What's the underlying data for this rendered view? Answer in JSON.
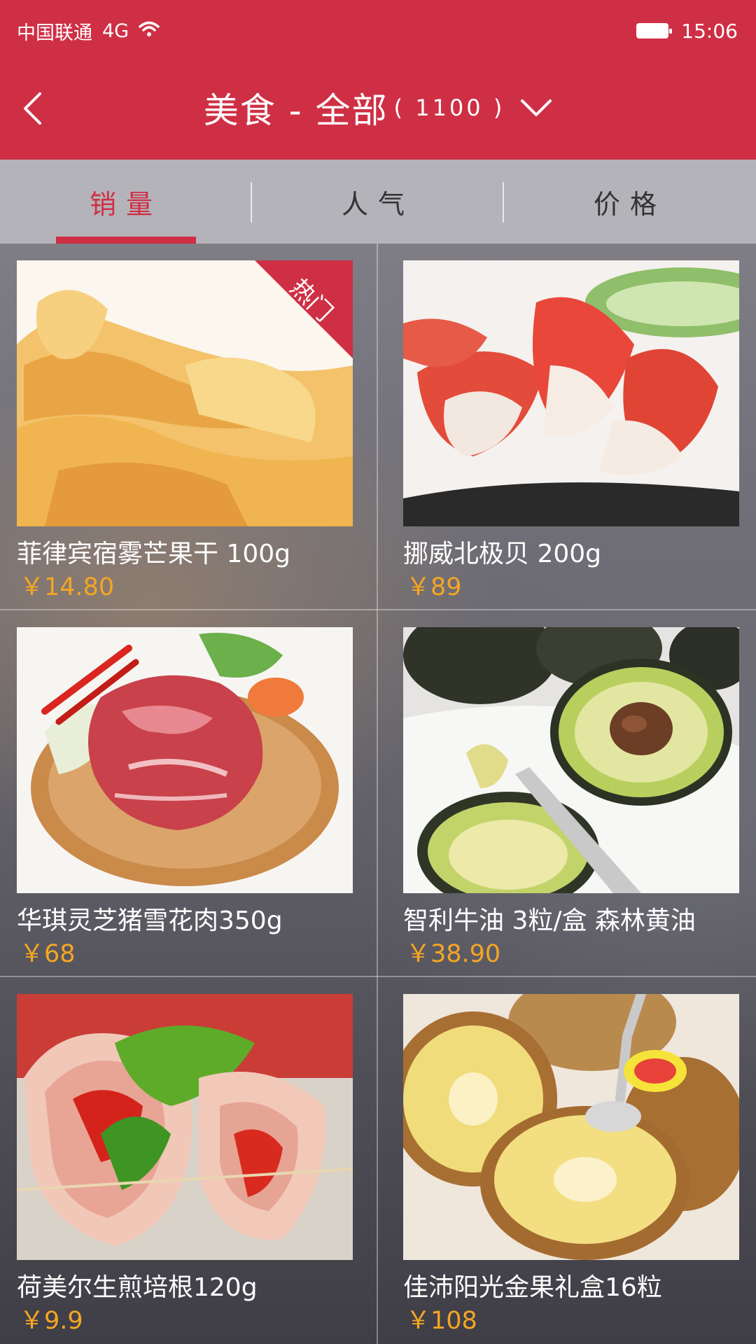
{
  "status_bar": {
    "carrier": "中国联通",
    "network": "4G",
    "time": "15:06"
  },
  "nav": {
    "title": "美食 - 全部",
    "count": "( 1100 )"
  },
  "tabs": [
    {
      "label": "销量",
      "active": true
    },
    {
      "label": "人气",
      "active": false
    },
    {
      "label": "价格",
      "active": false
    }
  ],
  "products": [
    {
      "name": "菲律宾宿雾芒果干 100g",
      "price": "￥14.80",
      "badge": "热门"
    },
    {
      "name": "挪威北极贝 200g",
      "price": "￥89"
    },
    {
      "name": "华琪灵芝猪雪花肉350g",
      "price": "￥68"
    },
    {
      "name": "智利牛油 3粒/盒 森林黄油",
      "price": "￥38.90"
    },
    {
      "name": "荷美尔生煎培根120g",
      "price": "￥9.9"
    },
    {
      "name": "佳沛阳光金果礼盒16粒",
      "price": "￥108"
    }
  ],
  "colors": {
    "brand_red": "#cf2f45",
    "price_orange": "#f5a623"
  }
}
